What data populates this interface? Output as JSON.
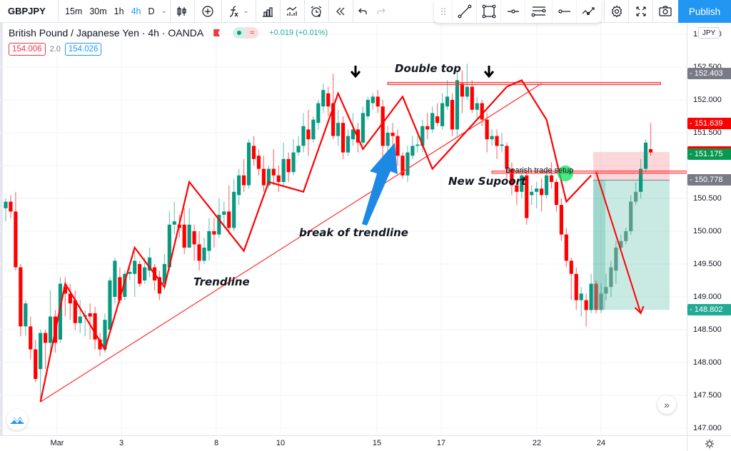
{
  "toolbar": {
    "symbol": "GBPJPY",
    "timeframes": [
      {
        "label": "15m",
        "active": false
      },
      {
        "label": "30m",
        "active": false
      },
      {
        "label": "1h",
        "active": false
      },
      {
        "label": "4h",
        "active": true
      },
      {
        "label": "D",
        "active": false
      }
    ],
    "buttons": [
      "chart-type",
      "compare",
      "indicators",
      "financials",
      "templates",
      "alert",
      "replay",
      "undo",
      "redo"
    ],
    "drawing_tools": [
      "drag-handle",
      "trend-line",
      "rectangle",
      "horizontal-ray",
      "parallel-channel",
      "horizontal-line",
      "path"
    ],
    "right_buttons": [
      "settings",
      "fullscreen",
      "snapshot"
    ],
    "publish_label": "Publish"
  },
  "legend": {
    "title": "British Pound / Japanese Yen · 4h · OANDA",
    "status_market": "●",
    "status_delayed": "≈",
    "change": "+0.019 (+0.01%)",
    "sell_price": "154.006",
    "spread": "2.0",
    "buy_price": "154.026"
  },
  "price_axis": {
    "currency": "JPY",
    "ticks": [
      "153.000",
      "152.500",
      "152.000",
      "151.500",
      "150.500",
      "150.000",
      "149.500",
      "149.000",
      "148.500",
      "148.000",
      "147.500",
      "147.000"
    ],
    "labels": [
      {
        "value": "152.403",
        "price": 152.403,
        "color": "#787b86"
      },
      {
        "value": "151.639",
        "price": 151.639,
        "color": "#ff0000"
      },
      {
        "value": "151.208",
        "price": 151.208,
        "color": "#ff0000"
      },
      {
        "value": "151.175",
        "price": 151.175,
        "color": "#089950"
      },
      {
        "value": "150.778",
        "price": 150.778,
        "color": "#787b86"
      },
      {
        "value": "148.802",
        "price": 148.802,
        "color": "#22ab94"
      }
    ]
  },
  "time_axis": {
    "labels": [
      "Mar",
      "3",
      "8",
      "10",
      "15",
      "17",
      "22",
      "24"
    ]
  },
  "annotations": {
    "double_top": "Double top",
    "break_of_trendline": "break of trendline",
    "trendline": "Trendline",
    "new_support": "New Supoort",
    "bearish_setup": "Bearish trade setup"
  },
  "colors": {
    "up": "#089981",
    "down": "#f23645",
    "accent": "#2196f3",
    "drawing": "#ff0000"
  },
  "chart_data": {
    "type": "candlestick",
    "symbol": "GBPJPY",
    "interval": "4h",
    "ylim": [
      146.9,
      153.2
    ],
    "candles": [
      [
        150.35,
        150.45,
        150.5,
        150.15
      ],
      [
        150.45,
        150.3,
        150.55,
        150.2
      ],
      [
        150.3,
        149.45,
        150.6,
        149.4
      ],
      [
        149.45,
        148.55,
        149.5,
        148.4
      ],
      [
        148.55,
        148.9,
        148.95,
        148.4
      ],
      [
        148.55,
        148.2,
        148.7,
        148.05
      ],
      [
        148.2,
        147.75,
        148.35,
        147.7
      ],
      [
        147.9,
        148.45,
        148.5,
        147.45
      ],
      [
        148.45,
        148.3,
        148.5,
        147.9
      ],
      [
        148.3,
        148.7,
        149.1,
        148.1
      ],
      [
        148.7,
        148.3,
        148.8,
        148.15
      ],
      [
        148.35,
        149.2,
        149.3,
        148.3
      ],
      [
        149.15,
        149.05,
        149.3,
        148.7
      ],
      [
        149.05,
        148.9,
        149.2,
        148.65
      ],
      [
        148.95,
        148.6,
        149.1,
        148.5
      ],
      [
        148.6,
        148.7,
        148.95,
        148.45
      ],
      [
        148.7,
        148.72,
        148.8,
        148.4
      ],
      [
        148.75,
        148.7,
        148.9,
        148.35
      ],
      [
        148.75,
        148.35,
        148.85,
        148.2
      ],
      [
        148.35,
        148.2,
        148.45,
        148.1
      ],
      [
        148.2,
        148.65,
        148.75,
        148.15
      ],
      [
        148.5,
        149.25,
        149.3,
        148.5
      ],
      [
        149.0,
        149.55,
        149.6,
        148.9
      ],
      [
        149.3,
        148.95,
        149.45,
        148.9
      ],
      [
        149.0,
        149.35,
        149.4,
        148.95
      ],
      [
        149.35,
        149.38,
        149.5,
        149.25
      ],
      [
        149.35,
        149.55,
        149.7,
        149.0
      ],
      [
        149.5,
        149.2,
        149.55,
        149.15
      ],
      [
        149.25,
        149.45,
        149.6,
        149.2
      ],
      [
        149.4,
        149.6,
        149.75,
        149.3
      ],
      [
        149.45,
        149.25,
        149.5,
        149.1
      ],
      [
        149.3,
        149.05,
        149.4,
        148.95
      ],
      [
        149.2,
        149.5,
        149.65,
        149.1
      ],
      [
        149.45,
        150.1,
        150.3,
        149.4
      ],
      [
        150.1,
        150.15,
        150.45,
        149.95
      ],
      [
        150.1,
        150.05,
        150.25,
        149.9
      ],
      [
        150.1,
        149.75,
        150.35,
        149.65
      ],
      [
        149.75,
        150.1,
        150.35,
        149.75
      ],
      [
        150.0,
        149.8,
        150.1,
        149.55
      ],
      [
        149.8,
        149.55,
        150.0,
        149.4
      ],
      [
        149.55,
        149.75,
        149.9,
        149.5
      ],
      [
        149.7,
        150.0,
        150.2,
        149.55
      ],
      [
        150.0,
        149.95,
        150.2,
        149.75
      ],
      [
        149.95,
        150.25,
        150.5,
        149.9
      ],
      [
        150.25,
        150.3,
        150.45,
        150.05
      ],
      [
        150.3,
        150.05,
        150.7,
        149.95
      ],
      [
        150.05,
        150.6,
        150.8,
        150.0
      ],
      [
        150.55,
        150.85,
        150.95,
        150.4
      ],
      [
        150.85,
        150.7,
        151.1,
        150.6
      ],
      [
        150.7,
        151.35,
        151.4,
        150.65
      ],
      [
        151.3,
        151.1,
        151.45,
        151.0
      ],
      [
        151.15,
        150.95,
        151.25,
        150.85
      ],
      [
        150.95,
        150.7,
        151.15,
        150.6
      ],
      [
        150.7,
        150.95,
        151.0,
        150.65
      ],
      [
        150.95,
        150.85,
        151.25,
        150.7
      ],
      [
        150.85,
        150.75,
        151.0,
        150.6
      ],
      [
        150.75,
        151.1,
        151.35,
        150.7
      ],
      [
        151.1,
        150.9,
        151.2,
        150.75
      ],
      [
        150.9,
        151.2,
        151.4,
        150.85
      ],
      [
        151.2,
        151.3,
        151.45,
        151.15
      ],
      [
        151.3,
        151.6,
        151.8,
        151.2
      ],
      [
        151.55,
        151.4,
        151.85,
        151.15
      ],
      [
        151.4,
        151.7,
        151.75,
        151.35
      ],
      [
        151.65,
        151.95,
        152.0,
        151.55
      ],
      [
        151.9,
        152.15,
        152.25,
        151.8
      ],
      [
        152.1,
        151.9,
        152.2,
        151.75
      ],
      [
        151.95,
        151.45,
        152.4,
        151.4
      ],
      [
        151.45,
        151.65,
        151.85,
        151.3
      ],
      [
        151.65,
        151.2,
        151.75,
        151.1
      ],
      [
        151.2,
        151.45,
        151.55,
        151.15
      ],
      [
        151.4,
        151.55,
        151.8,
        151.3
      ],
      [
        151.55,
        151.35,
        151.65,
        151.2
      ],
      [
        151.35,
        151.8,
        151.9,
        151.3
      ],
      [
        151.75,
        152.0,
        152.05,
        151.7
      ],
      [
        151.95,
        152.05,
        152.1,
        151.85
      ],
      [
        152.05,
        151.9,
        152.15,
        151.8
      ],
      [
        151.9,
        151.3,
        152.0,
        150.85
      ],
      [
        151.3,
        151.5,
        151.6,
        151.2
      ],
      [
        151.5,
        151.45,
        151.65,
        151.3
      ],
      [
        151.45,
        151.15,
        151.55,
        151.0
      ],
      [
        151.15,
        150.85,
        151.2,
        150.8
      ],
      [
        150.85,
        151.2,
        151.3,
        150.75
      ],
      [
        151.15,
        151.3,
        151.45,
        151.1
      ],
      [
        151.3,
        151.32,
        151.45,
        151.2
      ],
      [
        151.3,
        151.6,
        151.7,
        151.2
      ],
      [
        151.6,
        151.55,
        151.8,
        151.4
      ],
      [
        151.55,
        151.8,
        151.9,
        151.5
      ],
      [
        151.75,
        151.65,
        151.95,
        151.6
      ],
      [
        151.6,
        151.95,
        152.1,
        151.55
      ],
      [
        151.9,
        152.05,
        152.3,
        151.85
      ],
      [
        152.0,
        151.55,
        152.1,
        151.45
      ],
      [
        151.55,
        152.3,
        152.45,
        151.45
      ],
      [
        152.25,
        152.05,
        152.45,
        151.8
      ],
      [
        152.05,
        152.2,
        152.55,
        152.0
      ],
      [
        152.2,
        151.85,
        152.3,
        151.8
      ],
      [
        151.85,
        151.95,
        152.05,
        151.7
      ],
      [
        151.95,
        151.7,
        152.0,
        151.6
      ],
      [
        151.7,
        151.4,
        151.8,
        151.2
      ],
      [
        151.4,
        151.45,
        151.55,
        151.3
      ],
      [
        151.45,
        151.3,
        151.55,
        151.1
      ],
      [
        151.3,
        151.32,
        151.5,
        151.2
      ],
      [
        151.3,
        150.95,
        151.35,
        150.8
      ],
      [
        150.95,
        150.7,
        151.05,
        150.55
      ],
      [
        150.7,
        150.6,
        150.75,
        150.4
      ],
      [
        150.6,
        150.85,
        150.95,
        150.5
      ],
      [
        150.85,
        150.2,
        150.9,
        150.1
      ],
      [
        150.55,
        150.6,
        150.7,
        150.4
      ],
      [
        150.6,
        150.65,
        150.75,
        150.35
      ],
      [
        150.65,
        150.55,
        150.8,
        150.3
      ],
      [
        150.55,
        150.85,
        150.95,
        150.5
      ],
      [
        150.85,
        150.75,
        151.05,
        150.65
      ],
      [
        150.75,
        150.4,
        150.8,
        150.3
      ],
      [
        150.4,
        149.95,
        150.5,
        149.85
      ],
      [
        149.95,
        149.55,
        150.05,
        149.45
      ],
      [
        149.55,
        149.35,
        149.6,
        148.95
      ],
      [
        149.35,
        148.95,
        149.45,
        148.8
      ],
      [
        148.95,
        149.05,
        149.15,
        148.7
      ],
      [
        148.95,
        148.8,
        149.05,
        148.55
      ],
      [
        148.8,
        149.2,
        149.35,
        148.75
      ],
      [
        149.2,
        148.8,
        149.25,
        148.75
      ],
      [
        148.8,
        149.05,
        149.2,
        148.75
      ],
      [
        149.05,
        149.15,
        149.35,
        148.95
      ],
      [
        149.15,
        149.45,
        149.55,
        149.0
      ],
      [
        149.4,
        149.75,
        149.85,
        149.2
      ],
      [
        149.75,
        149.85,
        149.95,
        149.7
      ],
      [
        149.85,
        150.0,
        150.05,
        149.8
      ],
      [
        150.0,
        150.45,
        150.55,
        149.95
      ],
      [
        150.45,
        150.6,
        150.75,
        150.4
      ],
      [
        150.6,
        150.95,
        151.1,
        150.5
      ],
      [
        150.95,
        151.35,
        151.4,
        150.9
      ],
      [
        151.25,
        151.2,
        151.65,
        151.15
      ]
    ],
    "drawings": {
      "trendline": [
        [
          7,
          147.4
        ],
        [
          108,
          152.25
        ]
      ],
      "resistance": [
        [
          77,
          152.25
        ],
        [
          132,
          152.25
        ]
      ],
      "support": [
        [
          98,
          150.9
        ],
        [
          145,
          150.9
        ]
      ],
      "zigzag": [
        [
          7,
          147.4
        ],
        [
          12,
          149.2
        ],
        [
          20,
          148.2
        ],
        [
          26,
          149.75
        ],
        [
          32,
          149.15
        ],
        [
          37,
          150.75
        ],
        [
          48,
          149.7
        ],
        [
          53,
          150.75
        ],
        [
          60,
          150.6
        ],
        [
          67,
          152.1
        ],
        [
          72,
          151.25
        ],
        [
          80,
          152.05
        ],
        [
          86,
          150.95
        ],
        [
          101,
          152.2
        ],
        [
          104,
          152.3
        ],
        [
          109,
          151.7
        ],
        [
          113,
          150.45
        ],
        [
          118,
          150.85
        ]
      ],
      "short_trade": {
        "entry_index": 119,
        "exit_index": 143,
        "entry": 150.778,
        "stop": 151.208,
        "target": 148.802
      },
      "trade_arrow": [
        [
          119,
          150.9
        ],
        [
          128,
          148.75
        ]
      ]
    }
  }
}
